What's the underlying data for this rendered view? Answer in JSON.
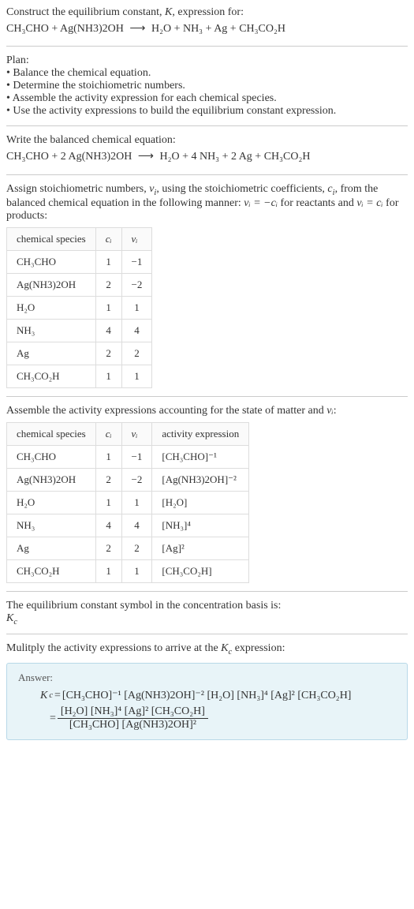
{
  "intro": {
    "line1_pre": "Construct the equilibrium constant, ",
    "line1_K": "K",
    "line1_post": ", expression for:",
    "reaction_lhs": "CH₃CHO + Ag(NH3)2OH",
    "reaction_arrow": "⟶",
    "reaction_rhs": "H₂O + NH₃ + Ag + CH₃CO₂H"
  },
  "plan": {
    "title": "Plan:",
    "items": [
      "Balance the chemical equation.",
      "Determine the stoichiometric numbers.",
      "Assemble the activity expression for each chemical species.",
      "Use the activity expressions to build the equilibrium constant expression."
    ]
  },
  "balanced": {
    "title": "Write the balanced chemical equation:",
    "lhs": "CH₃CHO + 2 Ag(NH3)2OH",
    "arrow": "⟶",
    "rhs": "H₂O + 4 NH₃ + 2 Ag + CH₃CO₂H"
  },
  "stoich": {
    "desc_pre": "Assign stoichiometric numbers, ",
    "desc_nu": "ν",
    "desc_i": "i",
    "desc_mid1": ", using the stoichiometric coefficients, ",
    "desc_c": "c",
    "desc_mid2": ", from the balanced chemical equation in the following manner: ",
    "desc_eq1": "νᵢ = −cᵢ",
    "desc_mid3": " for reactants and ",
    "desc_eq2": "νᵢ = cᵢ",
    "desc_post": " for products:",
    "headers": [
      "chemical species",
      "cᵢ",
      "νᵢ"
    ],
    "rows": [
      {
        "species": "CH₃CHO",
        "c": "1",
        "nu": "−1"
      },
      {
        "species": "Ag(NH3)2OH",
        "c": "2",
        "nu": "−2"
      },
      {
        "species": "H₂O",
        "c": "1",
        "nu": "1"
      },
      {
        "species": "NH₃",
        "c": "4",
        "nu": "4"
      },
      {
        "species": "Ag",
        "c": "2",
        "nu": "2"
      },
      {
        "species": "CH₃CO₂H",
        "c": "1",
        "nu": "1"
      }
    ]
  },
  "activity": {
    "desc_pre": "Assemble the activity expressions accounting for the state of matter and ",
    "desc_nu": "νᵢ",
    "desc_post": ":",
    "headers": [
      "chemical species",
      "cᵢ",
      "νᵢ",
      "activity expression"
    ],
    "rows": [
      {
        "species": "CH₃CHO",
        "c": "1",
        "nu": "−1",
        "expr": "[CH₃CHO]⁻¹"
      },
      {
        "species": "Ag(NH3)2OH",
        "c": "2",
        "nu": "−2",
        "expr": "[Ag(NH3)2OH]⁻²"
      },
      {
        "species": "H₂O",
        "c": "1",
        "nu": "1",
        "expr": "[H₂O]"
      },
      {
        "species": "NH₃",
        "c": "4",
        "nu": "4",
        "expr": "[NH₃]⁴"
      },
      {
        "species": "Ag",
        "c": "2",
        "nu": "2",
        "expr": "[Ag]²"
      },
      {
        "species": "CH₃CO₂H",
        "c": "1",
        "nu": "1",
        "expr": "[CH₃CO₂H]"
      }
    ]
  },
  "basis": {
    "line1": "The equilibrium constant symbol in the concentration basis is:",
    "symbol": "K",
    "symbol_sub": "c"
  },
  "multiply": {
    "line_pre": "Mulitply the activity expressions to arrive at the ",
    "kc": "K",
    "kc_sub": "c",
    "line_post": " expression:"
  },
  "answer": {
    "label": "Answer:",
    "kc": "K",
    "kc_sub": "c",
    "eq": " = ",
    "expr1": "[CH₃CHO]⁻¹ [Ag(NH3)2OH]⁻² [H₂O] [NH₃]⁴ [Ag]² [CH₃CO₂H]",
    "eq2": "= ",
    "num": "[H₂O] [NH₃]⁴ [Ag]² [CH₃CO₂H]",
    "den": "[CH₃CHO] [Ag(NH3)2OH]²"
  }
}
